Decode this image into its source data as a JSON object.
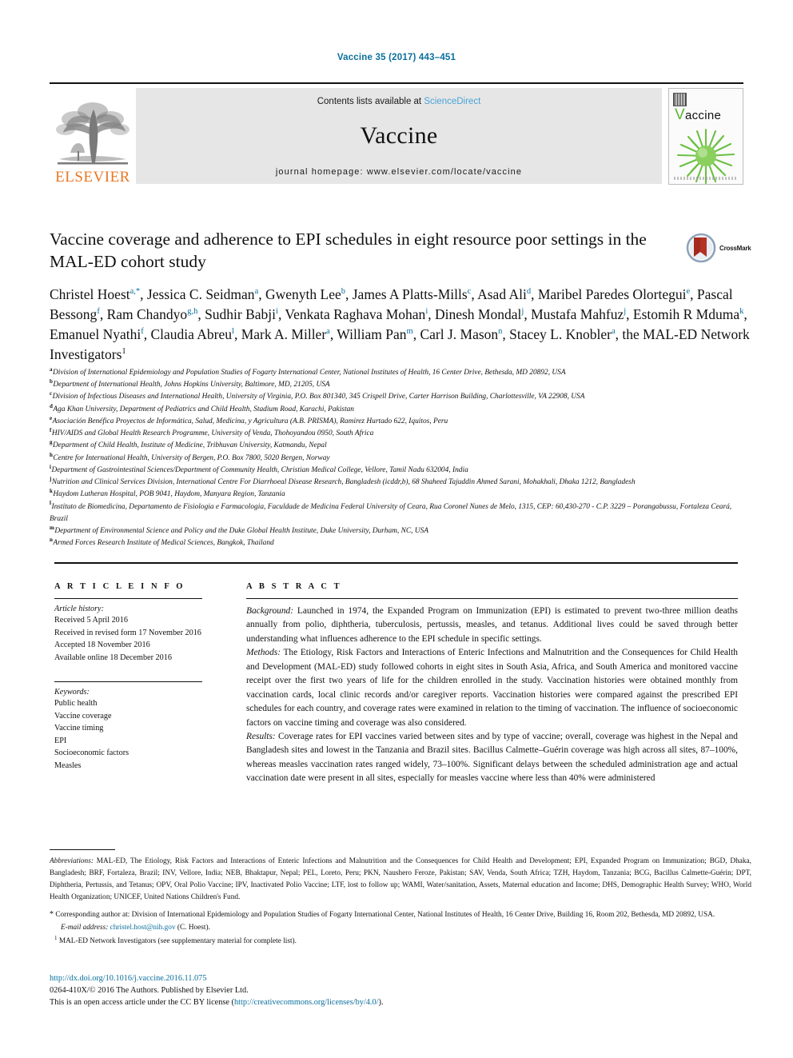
{
  "running_head": "Vaccine 35 (2017) 443–451",
  "masthead": {
    "publisher": "ELSEVIER",
    "contents_prefix": "Contents lists available at ",
    "contents_link": "ScienceDirect",
    "journal": "Vaccine",
    "homepage": "journal homepage: www.elsevier.com/locate/vaccine",
    "cover_title_initial": "V",
    "cover_title_rest": "accine"
  },
  "title": "Vaccine coverage and adherence to EPI schedules in eight resource poor settings in the MAL-ED cohort study",
  "crossmark_label": "CrossMark",
  "authors_html": "Christel Hoest<sup class=\"aff\">a,*</sup>, Jessica C. Seidman<sup class=\"aff\">a</sup>, Gwenyth Lee<sup class=\"aff\">b</sup>, James A Platts-Mills<sup class=\"aff\">c</sup>, Asad Ali<sup class=\"aff\">d</sup>, Maribel Paredes Olortegui<sup class=\"aff\">e</sup>, Pascal Bessong<sup class=\"aff\">f</sup>, Ram Chandyo<sup class=\"aff\">g,h</sup>, Sudhir Babji<sup class=\"aff\">i</sup>, Venkata Raghava Mohan<sup class=\"aff\">i</sup>, Dinesh Mondal<sup class=\"aff\">j</sup>, Mustafa Mahfuz<sup class=\"aff\">j</sup>, Estomih R Mduma<sup class=\"aff\">k</sup>, Emanuel Nyathi<sup class=\"aff\">f</sup>, Claudia Abreu<sup class=\"aff\">l</sup>, Mark A. Miller<sup class=\"aff\">a</sup>, William Pan<sup class=\"aff\">m</sup>, Carl J. Mason<sup class=\"aff\">n</sup>, Stacey L. Knobler<sup class=\"aff\">a</sup>, the MAL-ED Network Investigators<sup class=\"aff aff-black\">1</sup>",
  "affiliations": [
    {
      "mark": "a",
      "text": "Division of International Epidemiology and Population Studies of Fogarty International Center, National Institutes of Health, 16 Center Drive, Bethesda, MD 20892, USA"
    },
    {
      "mark": "b",
      "text": "Department of International Health, Johns Hopkins University, Baltimore, MD, 21205, USA"
    },
    {
      "mark": "c",
      "text": "Division of Infectious Diseases and International Health, University of Virginia, P.O. Box 801340, 345 Crispell Drive, Carter Harrison Building, Charlottesville, VA 22908, USA"
    },
    {
      "mark": "d",
      "text": "Aga Khan University, Department of Pediatrics and Child Health, Stadium Road, Karachi, Pakistan"
    },
    {
      "mark": "e",
      "text": "Asociación Benéfica Proyectos de Informática, Salud, Medicina, y Agricultura (A.B. PRISMA), Ramirez Hurtado 622, Iquitos, Peru"
    },
    {
      "mark": "f",
      "text": "HIV/AIDS and Global Health Research Programme, University of Venda, Thohoyandou 0950, South Africa"
    },
    {
      "mark": "g",
      "text": "Department of Child Health, Institute of Medicine, Tribhuvan University, Katmandu, Nepal"
    },
    {
      "mark": "h",
      "text": "Centre for International Health, University of Bergen, P.O. Box 7800, 5020 Bergen, Norway"
    },
    {
      "mark": "i",
      "text": "Department of Gastrointestinal Sciences/Department of Community Health, Christian Medical College, Vellore, Tamil Nadu 632004, India"
    },
    {
      "mark": "j",
      "text": "Nutrition and Clinical Services Division, International Centre For Diarrhoeal Disease Research, Bangladesh (icddr,b), 68 Shaheed Tajuddin Ahmed Sarani, Mohakhali, Dhaka 1212, Bangladesh"
    },
    {
      "mark": "k",
      "text": "Haydom Lutheran Hospital, POB 9041, Haydom, Manyara Region, Tanzania"
    },
    {
      "mark": "l",
      "text": "Instituto de Biomedicina, Departamento de Fisiologia e Farmacologia, Faculdade de Medicina Federal University of Ceara, Rua Coronel Nunes de Melo, 1315, CEP: 60,430-270 - C.P. 3229 – Porangabussu, Fortaleza Ceará, Brazil"
    },
    {
      "mark": "m",
      "text": "Department of Environmental Science and Policy and the Duke Global Health Institute, Duke University, Durham, NC, USA"
    },
    {
      "mark": "n",
      "text": "Armed Forces Research Institute of Medical Sciences, Bangkok, Thailand"
    }
  ],
  "article_info": {
    "heading": "A R T I C L E   I N F O",
    "history_label": "Article history:",
    "history": [
      "Received 5 April 2016",
      "Received in revised form 17 November 2016",
      "Accepted 18 November 2016",
      "Available online 18 December 2016"
    ],
    "keywords_label": "Keywords:",
    "keywords": [
      "Public health",
      "Vaccine coverage",
      "Vaccine timing",
      "EPI",
      "Socioeconomic factors",
      "Measles"
    ]
  },
  "abstract": {
    "heading": "A B S T R A C T",
    "paragraphs": [
      {
        "label": "Background:",
        "text": " Launched in 1974, the Expanded Program on Immunization (EPI) is estimated to prevent two-three million deaths annually from polio, diphtheria, tuberculosis, pertussis, measles, and tetanus. Additional lives could be saved through better understanding what influences adherence to the EPI schedule in specific settings."
      },
      {
        "label": "Methods:",
        "text": " The Etiology, Risk Factors and Interactions of Enteric Infections and Malnutrition and the Consequences for Child Health and Development (MAL-ED) study followed cohorts in eight sites in South Asia, Africa, and South America and monitored vaccine receipt over the first two years of life for the children enrolled in the study. Vaccination histories were obtained monthly from vaccination cards, local clinic records and/or caregiver reports. Vaccination histories were compared against the prescribed EPI schedules for each country, and coverage rates were examined in relation to the timing of vaccination. The influence of socioeconomic factors on vaccine timing and coverage was also considered."
      },
      {
        "label": "Results:",
        "text": " Coverage rates for EPI vaccines varied between sites and by type of vaccine; overall, coverage was highest in the Nepal and Bangladesh sites and lowest in the Tanzania and Brazil sites. Bacillus Calmette–Guérin coverage was high across all sites, 87–100%, whereas measles vaccination rates ranged widely, 73–100%. Significant delays between the scheduled administration age and actual vaccination date were present in all sites, especially for measles vaccine where less than 40% were administered"
      }
    ]
  },
  "footnotes": {
    "abbreviations_label": "Abbreviations:",
    "abbreviations_text": " MAL-ED, The Etiology, Risk Factors and Interactions of Enteric Infections and Malnutrition and the Consequences for Child Health and Development; EPI, Expanded Program on Immunization; BGD, Dhaka, Bangladesh; BRF, Fortaleza, Brazil; INV, Vellore, India; NEB, Bhaktapur, Nepal; PEL, Loreto, Peru; PKN, Naushero Feroze, Pakistan; SAV, Venda, South Africa; TZH, Haydom, Tanzania; BCG, Bacillus Calmette-Guérin; DPT, Diphtheria, Pertussis, and Tetanus; OPV, Oral Polio Vaccine; IPV, Inactivated Polio Vaccine; LTF, lost to follow up; WAMI, Water/sanitation, Assets, Maternal education and Income; DHS, Demographic Health Survey; WHO, World Health Organization; UNICEF, United Nations Children's Fund.",
    "corresponding": "Corresponding author at: Division of International Epidemiology and Population Studies of Fogarty International Center, National Institutes of Health, 16 Center Drive, Building 16, Room 202, Bethesda, MD 20892, USA.",
    "email_label": "E-mail address:",
    "email": "christel.host@nih.gov",
    "email_suffix": " (C. Hoest).",
    "investigators_note": "MAL-ED Network Investigators (see supplementary material for complete list)."
  },
  "bottom": {
    "doi": "http://dx.doi.org/10.1016/j.vaccine.2016.11.075",
    "copyright": "0264-410X/© 2016 The Authors. Published by Elsevier Ltd.",
    "license_prefix": "This is an open access article under the CC BY license (",
    "license_link": "http://creativecommons.org/licenses/by/4.0/",
    "license_suffix": ")."
  },
  "colors": {
    "link": "#0a6f9c",
    "elsevier_orange": "#e87722",
    "cover_green": "#5cb531",
    "masthead_grey": "#e6e6e6"
  }
}
